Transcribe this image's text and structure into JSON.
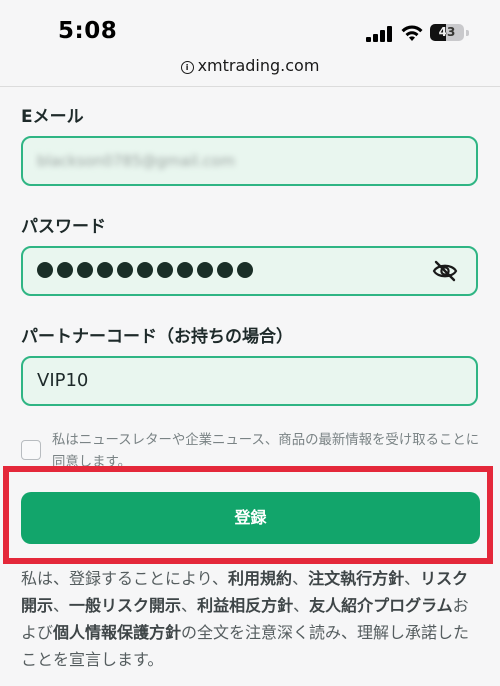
{
  "status": {
    "time": "5:08",
    "battery": "43"
  },
  "browser": {
    "url": "xmtrading.com"
  },
  "form": {
    "email_label": "Eメール",
    "email_value": "blackson0785@gmail.com",
    "password_label": "パスワード",
    "partner_label": "パートナーコード（お持ちの場合）",
    "partner_value": "VIP10",
    "consent_text": "私はニュースレターや企業ニュース、商品の最新情報を受け取ることに同意します。",
    "submit_label": "登録"
  },
  "terms": {
    "t1": "私は、登録することにより、",
    "l1": "利用規約",
    "s1": "、",
    "l2": "注文執行方針",
    "s2": "、",
    "l3": "リスク開示",
    "s3": "、",
    "l4": "一般リスク開示",
    "s4": "、",
    "l5": "利益相反方針",
    "s5": "、",
    "l6": "友人紹介プログラム",
    "t2": "および",
    "l7": "個人情報保護方針",
    "t3": "の全文を注意深く読み、理解し承諾したことを宣言します。"
  },
  "colors": {
    "accent": "#12a56b",
    "field_border": "#2fb584",
    "highlight": "#e4283a"
  }
}
